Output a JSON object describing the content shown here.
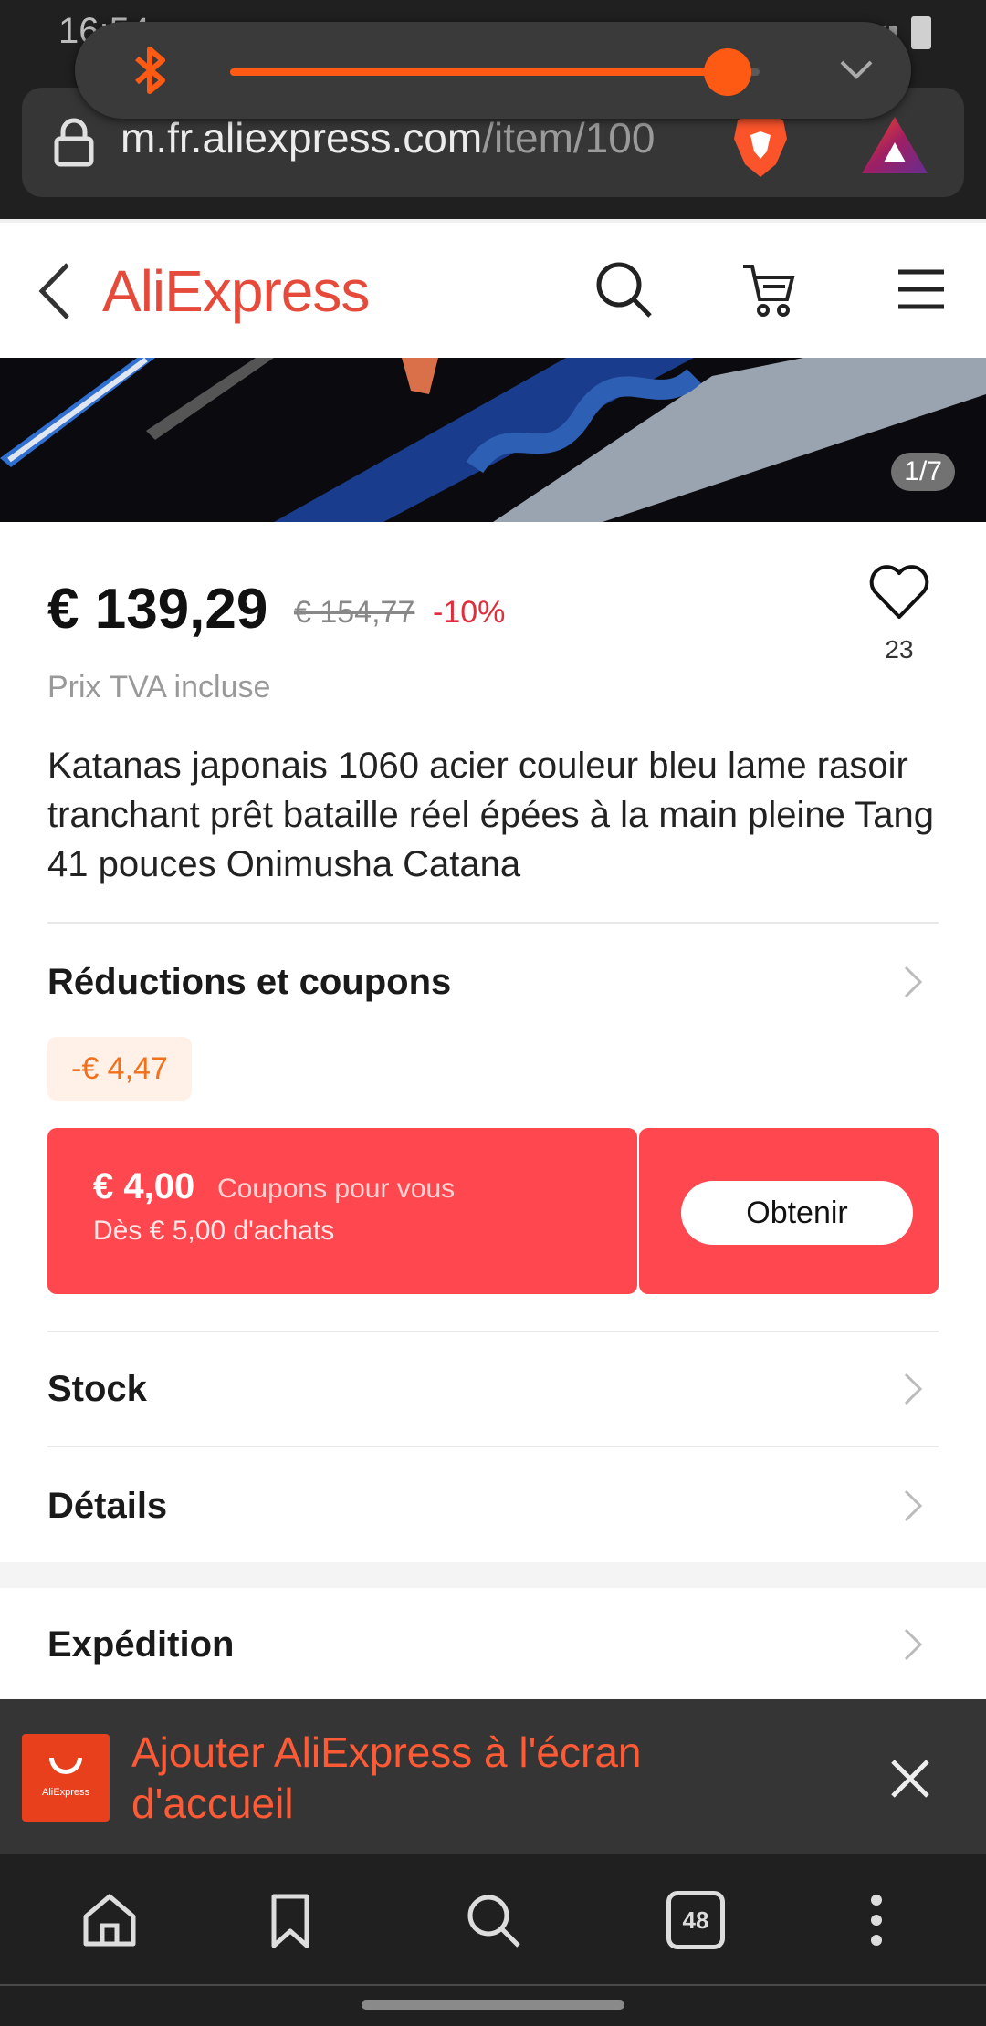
{
  "status": {
    "time": "16:54"
  },
  "volume": {
    "level_percent": 94
  },
  "browser": {
    "url_domain": "m.fr.aliexpress.com",
    "url_path": "/item/100",
    "tab_count": "48"
  },
  "header": {
    "logo": "AliExpress"
  },
  "gallery": {
    "counter": "1/7"
  },
  "product": {
    "price": "€ 139,29",
    "old_price": "€ 154,77",
    "discount": "-10%",
    "wishlist_count": "23",
    "vat_note": "Prix TVA incluse",
    "title": "Katanas japonais 1060 acier couleur bleu lame rasoir tranchant prêt bataille réel épées à la main pleine Tang 41 pouces Onimusha Catana"
  },
  "sections": {
    "coupons_label": "Réductions et coupons",
    "promo_chip": "-€ 4,47",
    "stock_label": "Stock",
    "details_label": "Détails",
    "shipping_label": "Expédition"
  },
  "coupon": {
    "value": "€ 4,00",
    "title": "Coupons pour vous",
    "min_spend": "Dès € 5,00 d'achats",
    "button": "Obtenir"
  },
  "a2hs": {
    "text": "Ajouter AliExpress à l'écran d'accueil",
    "logo_text": "AliExpress"
  },
  "colors": {
    "accent": "#ff5a14",
    "brand": "#e64a3b",
    "coupon": "#ff474f"
  }
}
